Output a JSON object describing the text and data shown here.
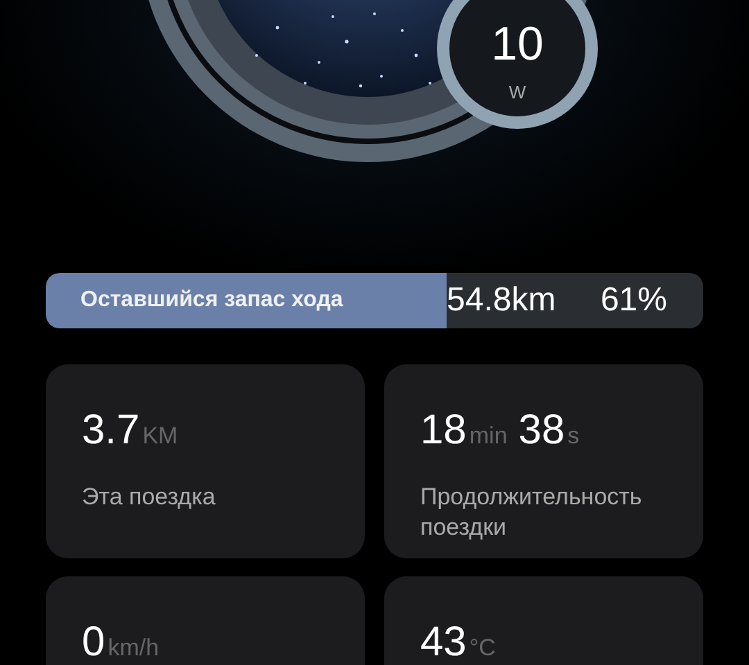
{
  "power": {
    "value": "10",
    "unit": "W"
  },
  "range": {
    "label": "Оставшийся запас хода",
    "level": 0.61,
    "distance": "54.8km",
    "percent": "61%"
  },
  "stats": [
    {
      "parts": [
        {
          "value": "3.7",
          "unit": "KM"
        }
      ],
      "label": "Эта поездка"
    },
    {
      "parts": [
        {
          "value": "18",
          "unit": "min"
        },
        {
          "value": "38",
          "unit": "s"
        }
      ],
      "label": "Продолжительность поездки"
    },
    {
      "parts": [
        {
          "value": "0",
          "unit": "km/h"
        }
      ]
    },
    {
      "parts": [
        {
          "value": "43",
          "unit": "°C"
        }
      ]
    }
  ]
}
